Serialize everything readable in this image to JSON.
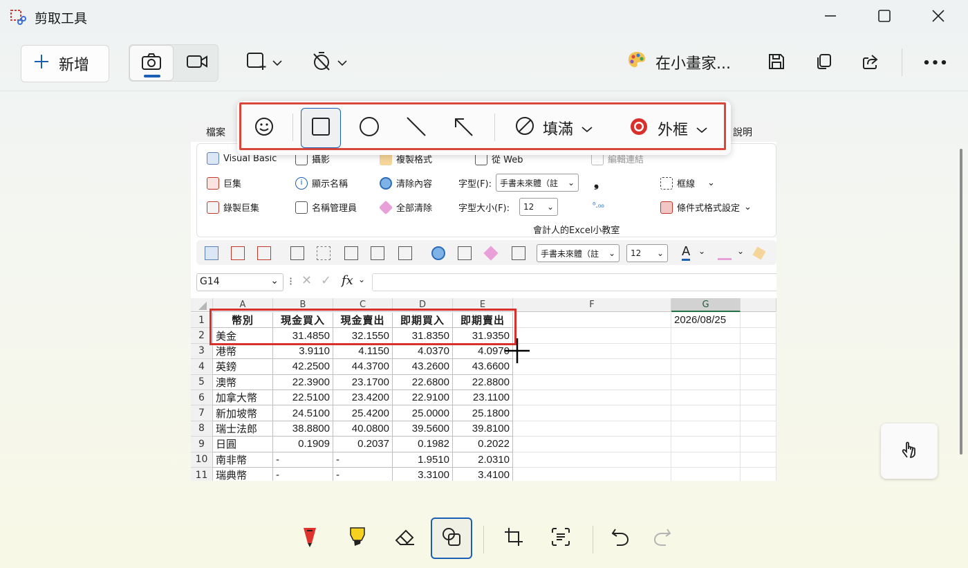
{
  "window": {
    "title": "剪取工具",
    "minimize_icon": "minimize-icon",
    "maximize_icon": "maximize-icon",
    "close_icon": "close-icon"
  },
  "toolbar": {
    "new_label": "新增",
    "paint_label": "在小畫家...",
    "more_label": "•••"
  },
  "shape_toolbar": {
    "fill_label": "填滿",
    "outline_label": "外框"
  },
  "excel": {
    "tabs": {
      "file": "檔案",
      "help": "說明"
    },
    "ribbon": {
      "vba": "Visual Basic",
      "macros": "巨集",
      "record_macro": "錄製巨集",
      "camera": "攝影",
      "show_name": "顯示名稱",
      "name_manager": "名稱管理員",
      "copy_format": "複製格式",
      "clear_content": "清除內容",
      "clear_all": "全部清除",
      "from_web": "從 Web",
      "font_label": "字型(F):",
      "font_value": "手書未來體（註",
      "font_size_label": "字型大小(F):",
      "font_size_value": "12",
      "edit_links": "編輯連結",
      "borders": "框線",
      "conditional_format": "條件式格式設定",
      "group_title": "會計人的Excel小教室"
    },
    "qat": {
      "font_value": "手書未來體（註",
      "font_size_value": "12"
    },
    "formula_bar": {
      "name_box": "G14",
      "fx": "fx"
    },
    "columns": [
      "A",
      "B",
      "C",
      "D",
      "E",
      "F",
      "G"
    ],
    "date_cell": "2026/08/25",
    "table": {
      "headers": [
        "幣別",
        "現金買入",
        "現金賣出",
        "即期買入",
        "即期賣出"
      ],
      "rows": [
        {
          "num": "1"
        },
        {
          "num": "2",
          "cells": [
            "美金",
            "31.4850",
            "32.1550",
            "31.8350",
            "31.9350"
          ]
        },
        {
          "num": "3",
          "cells": [
            "港幣",
            "3.9110",
            "4.1150",
            "4.0370",
            "4.0970"
          ]
        },
        {
          "num": "4",
          "cells": [
            "英鎊",
            "42.2500",
            "44.3700",
            "43.2600",
            "43.6600"
          ]
        },
        {
          "num": "5",
          "cells": [
            "澳幣",
            "22.3900",
            "23.1700",
            "22.6800",
            "22.8800"
          ]
        },
        {
          "num": "6",
          "cells": [
            "加拿大幣",
            "22.5100",
            "23.4200",
            "22.9100",
            "23.1100"
          ]
        },
        {
          "num": "7",
          "cells": [
            "新加坡幣",
            "24.5100",
            "25.4200",
            "25.0000",
            "25.1800"
          ]
        },
        {
          "num": "8",
          "cells": [
            "瑞士法郎",
            "38.8800",
            "40.0800",
            "39.5600",
            "39.8100"
          ]
        },
        {
          "num": "9",
          "cells": [
            "日圓",
            "0.1909",
            "0.2037",
            "0.1982",
            "0.2022"
          ]
        },
        {
          "num": "10",
          "cells": [
            "南非幣",
            "-",
            "-",
            "1.9510",
            "2.0310"
          ]
        },
        {
          "num": "11",
          "cells": [
            "瑞典幣",
            "-",
            "-",
            "3.3100",
            "3.4100"
          ]
        }
      ]
    }
  },
  "colors": {
    "accent": "#1a5fb4",
    "highlight_red": "#d9302c"
  }
}
